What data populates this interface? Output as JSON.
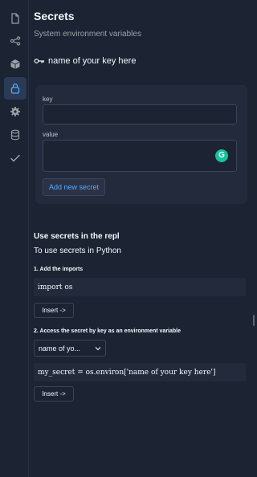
{
  "rail": {
    "items": [
      {
        "icon": "file-icon",
        "active": false
      },
      {
        "icon": "share-icon",
        "active": false
      },
      {
        "icon": "package-icon",
        "active": false
      },
      {
        "icon": "lock-icon",
        "active": true
      },
      {
        "icon": "gear-icon",
        "active": false
      },
      {
        "icon": "database-icon",
        "active": false
      },
      {
        "icon": "check-icon",
        "active": false
      }
    ]
  },
  "header": {
    "title": "Secrets",
    "subtitle": "System environment variables"
  },
  "key_row": {
    "label": "name of your key here"
  },
  "form": {
    "key_label": "key",
    "key_value": "",
    "value_label": "value",
    "value_value": "",
    "add_button": "Add new secret",
    "grammarly_glyph": "G"
  },
  "usage": {
    "title": "Use secrets in the repl",
    "subtitle": "To use secrets in Python",
    "step1": "1. Add the imports",
    "code1": "import os",
    "insert1": "Insert ->",
    "step2": "2. Access the secret by key as an environment variable",
    "select_value": "name of yo...",
    "code2": "my_secret = os.environ['name of your key here']",
    "insert2": "Insert ->"
  },
  "colors": {
    "background": "#1c2333",
    "card": "#232a3b",
    "accent": "#57abff",
    "grammarly": "#15c39a"
  }
}
